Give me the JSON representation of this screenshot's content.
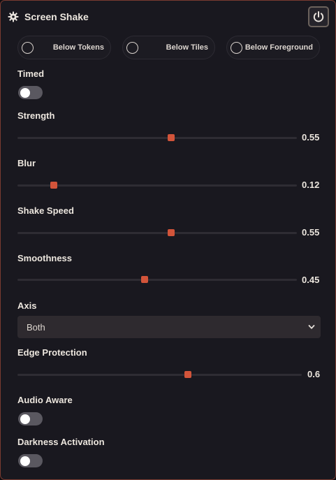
{
  "header": {
    "title": "Screen Shake",
    "icon": "gear-icon",
    "power_icon": "power-icon"
  },
  "modes": [
    {
      "label": "Below Tokens",
      "selected": false
    },
    {
      "label": "Below Tiles",
      "selected": false
    },
    {
      "label": "Below Foreground",
      "selected": false
    }
  ],
  "timed": {
    "label": "Timed",
    "on": false
  },
  "strength": {
    "label": "Strength",
    "value": "0.55",
    "fraction": 0.55
  },
  "blur": {
    "label": "Blur",
    "value": "0.12",
    "fraction": 0.13
  },
  "shake_speed": {
    "label": "Shake Speed",
    "value": "0.55",
    "fraction": 0.55
  },
  "smoothness": {
    "label": "Smoothness",
    "value": "0.45",
    "fraction": 0.455
  },
  "axis": {
    "label": "Axis",
    "selected": "Both"
  },
  "edge_protection": {
    "label": "Edge Protection",
    "value": "0.6",
    "fraction": 0.6
  },
  "audio_aware": {
    "label": "Audio Aware",
    "on": false
  },
  "darkness_activation": {
    "label": "Darkness Activation",
    "on": false
  },
  "colors": {
    "accent": "#d2543a",
    "panel": "#19181f",
    "border": "#7a3b30"
  }
}
